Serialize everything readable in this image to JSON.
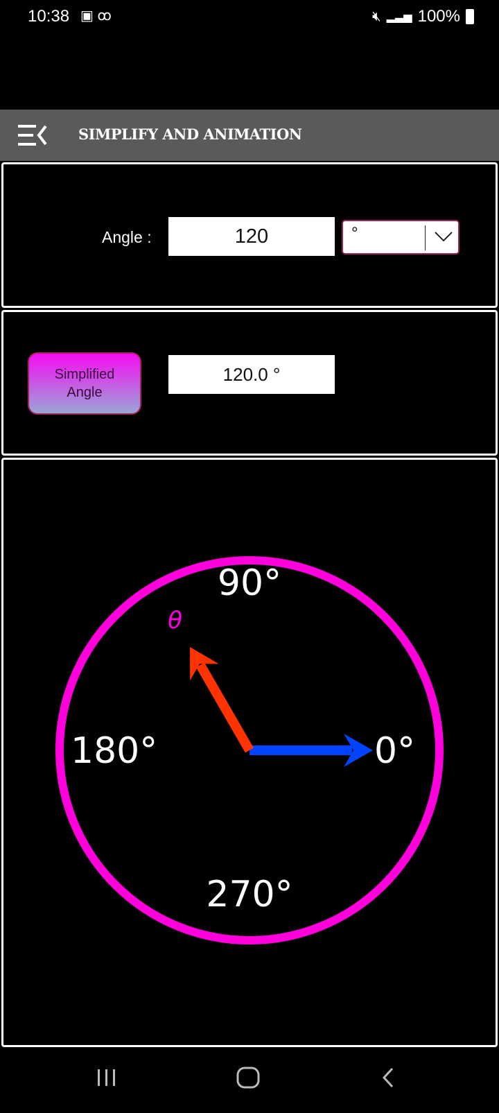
{
  "status_bar": {
    "time": "10:38",
    "battery": "100%",
    "icons": [
      "gallery-icon",
      "voicemail-icon",
      "mute-icon",
      "signal-icon",
      "battery-icon"
    ]
  },
  "app_bar": {
    "title": "SIMPLIFY AND ANIMATION",
    "menu_icon": "menu-collapse-icon"
  },
  "input_panel": {
    "label": "Angle :",
    "angle_value": "120",
    "unit_selected": "°"
  },
  "result_panel": {
    "button_label_line1": "Simplified",
    "button_label_line2": "Angle",
    "result_value": "120.0 °"
  },
  "diagram": {
    "labels": {
      "right": "0°",
      "top": "90°",
      "left": "180°",
      "bottom": "270°"
    },
    "angle_symbol": "θ",
    "angle_degrees": 120,
    "colors": {
      "circle": "#ff00dd",
      "reference_arrow": "#0044ff",
      "angle_arrow": "#ff3300"
    }
  },
  "nav_bar": {
    "icons": [
      "recent-apps-icon",
      "home-icon",
      "back-icon"
    ]
  }
}
